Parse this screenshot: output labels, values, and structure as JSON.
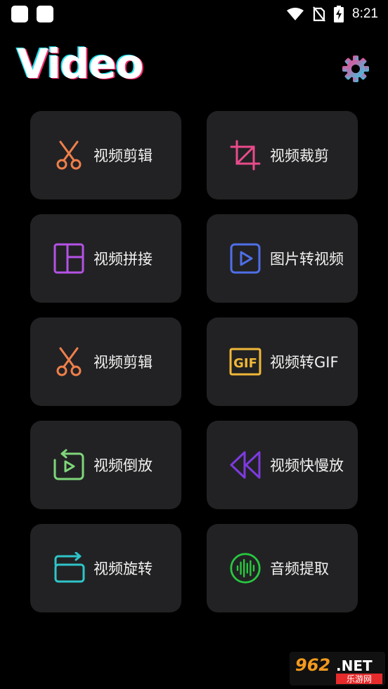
{
  "status_bar": {
    "time": "8:21"
  },
  "header": {
    "title": "Video"
  },
  "tiles": [
    {
      "label": "视频剪辑",
      "icon": "scissors-icon",
      "color": "#f07f4a"
    },
    {
      "label": "视频裁剪",
      "icon": "crop-icon",
      "color": "#e94b8c"
    },
    {
      "label": "视频拼接",
      "icon": "layout-icon",
      "color": "#b552e6"
    },
    {
      "label": "图片转视频",
      "icon": "play-square-icon",
      "color": "#4f6fe8"
    },
    {
      "label": "视频剪辑",
      "icon": "scissors-icon",
      "color": "#f07f4a"
    },
    {
      "label": "视频转GIF",
      "icon": "gif-icon",
      "color": "#f0b838"
    },
    {
      "label": "视频倒放",
      "icon": "reverse-play-icon",
      "color": "#7ed67a"
    },
    {
      "label": "视频快慢放",
      "icon": "rewind-icon",
      "color": "#7d3ae0"
    },
    {
      "label": "视频旋转",
      "icon": "rotate-icon",
      "color": "#2fc4c9"
    },
    {
      "label": "音频提取",
      "icon": "audio-wave-icon",
      "color": "#28c93f"
    }
  ],
  "watermark": {
    "brand": "962.NET",
    "subtitle": "乐游网"
  }
}
